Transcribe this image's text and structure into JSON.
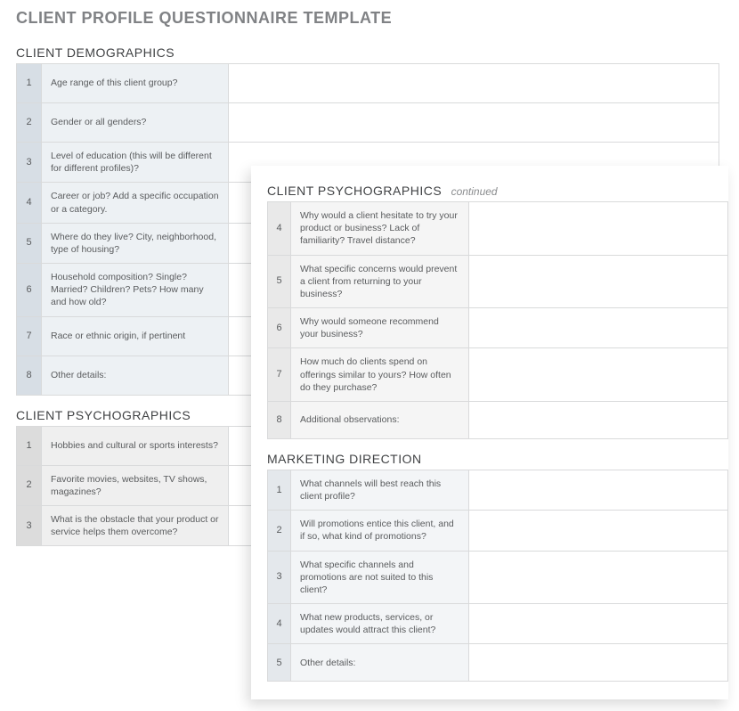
{
  "title": "CLIENT PROFILE QUESTIONNAIRE TEMPLATE",
  "continued_label": "continued",
  "sections": {
    "demographics": {
      "title": "CLIENT DEMOGRAPHICS",
      "rows": [
        {
          "n": "1",
          "q": "Age range of this client group?"
        },
        {
          "n": "2",
          "q": "Gender or all genders?"
        },
        {
          "n": "3",
          "q": "Level of education (this will be different for different profiles)?"
        },
        {
          "n": "4",
          "q": "Career or job? Add a specific occupation or a category."
        },
        {
          "n": "5",
          "q": "Where do they live? City, neighborhood, type of housing?"
        },
        {
          "n": "6",
          "q": "Household composition? Single? Married? Children? Pets? How many and how old?"
        },
        {
          "n": "7",
          "q": "Race or ethnic origin, if pertinent"
        },
        {
          "n": "8",
          "q": "Other details:"
        }
      ]
    },
    "psychographics_a": {
      "title": "CLIENT PSYCHOGRAPHICS",
      "rows": [
        {
          "n": "1",
          "q": "Hobbies and cultural or sports interests?"
        },
        {
          "n": "2",
          "q": "Favorite movies, websites, TV shows, magazines?"
        },
        {
          "n": "3",
          "q": "What is the obstacle that your product or service helps them overcome?"
        }
      ]
    },
    "psychographics_b": {
      "title": "CLIENT PSYCHOGRAPHICS",
      "rows": [
        {
          "n": "4",
          "q": "Why would a client hesitate to try your product or business? Lack of familiarity? Travel distance?"
        },
        {
          "n": "5",
          "q": "What specific concerns would prevent a client from returning to your business?"
        },
        {
          "n": "6",
          "q": "Why would someone recommend your business?"
        },
        {
          "n": "7",
          "q": "How much do clients spend on offerings similar to yours? How often do they purchase?"
        },
        {
          "n": "8",
          "q": "Additional observations:"
        }
      ]
    },
    "marketing": {
      "title": "MARKETING DIRECTION",
      "rows": [
        {
          "n": "1",
          "q": "What channels will best reach this client profile?"
        },
        {
          "n": "2",
          "q": "Will promotions entice this client, and if so, what kind of promotions?"
        },
        {
          "n": "3",
          "q": "What specific channels and promotions are not suited to this client?"
        },
        {
          "n": "4",
          "q": "What new products, services, or updates would attract this client?"
        },
        {
          "n": "5",
          "q": "Other details:"
        }
      ]
    }
  }
}
